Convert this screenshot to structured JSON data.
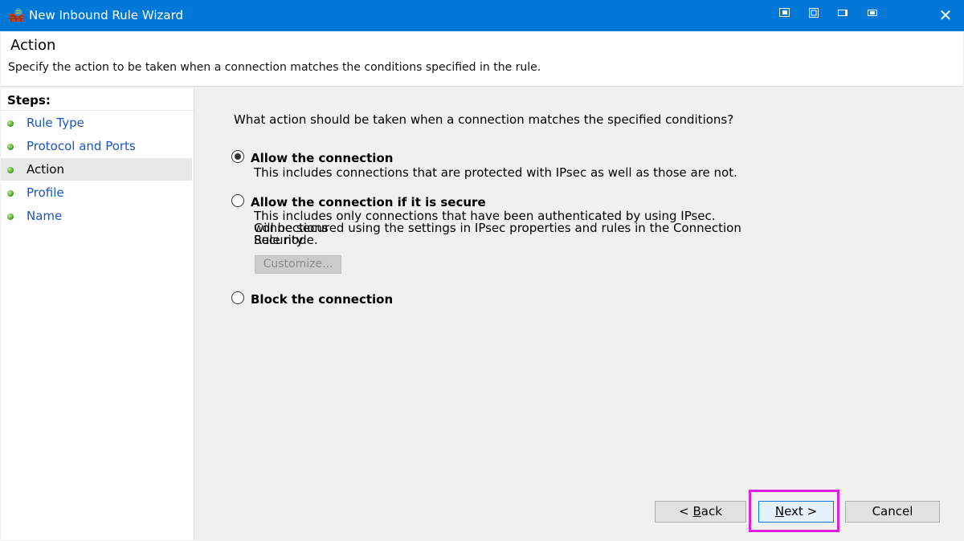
{
  "window": {
    "title": "New Inbound Rule Wizard",
    "close_glyph": "✕"
  },
  "header": {
    "title": "Action",
    "description": "Specify the action to be taken when a connection matches the conditions specified in the rule."
  },
  "steps": {
    "label": "Steps:",
    "items": [
      {
        "label": "Rule Type",
        "current": false
      },
      {
        "label": "Protocol and Ports",
        "current": false
      },
      {
        "label": "Action",
        "current": true
      },
      {
        "label": "Profile",
        "current": false
      },
      {
        "label": "Name",
        "current": false
      }
    ]
  },
  "main": {
    "question": "What action should be taken when a connection matches the specified conditions?",
    "options": [
      {
        "label": "Allow the connection",
        "description": "This includes connections that are protected with IPsec as well as those are not.",
        "selected": true
      },
      {
        "label": "Allow the connection if it is secure",
        "description_lines": [
          "This includes only connections that have been authenticated by using IPsec.  Connections",
          "will be secured using the settings in IPsec properties and rules in the Connection Security",
          "Rule node."
        ],
        "selected": false
      },
      {
        "label": "Block the connection",
        "selected": false
      }
    ],
    "customize_label": "Customize..."
  },
  "buttons": {
    "back": {
      "mnemonic": "B",
      "rest": "ack",
      "prefix": "< "
    },
    "next": {
      "mnemonic": "N",
      "rest": "ext",
      "suffix": " >"
    },
    "cancel": "Cancel"
  },
  "colors": {
    "titlebar": "#0078d7",
    "step_link": "#1a55c8",
    "highlight": "#e01fe0"
  }
}
